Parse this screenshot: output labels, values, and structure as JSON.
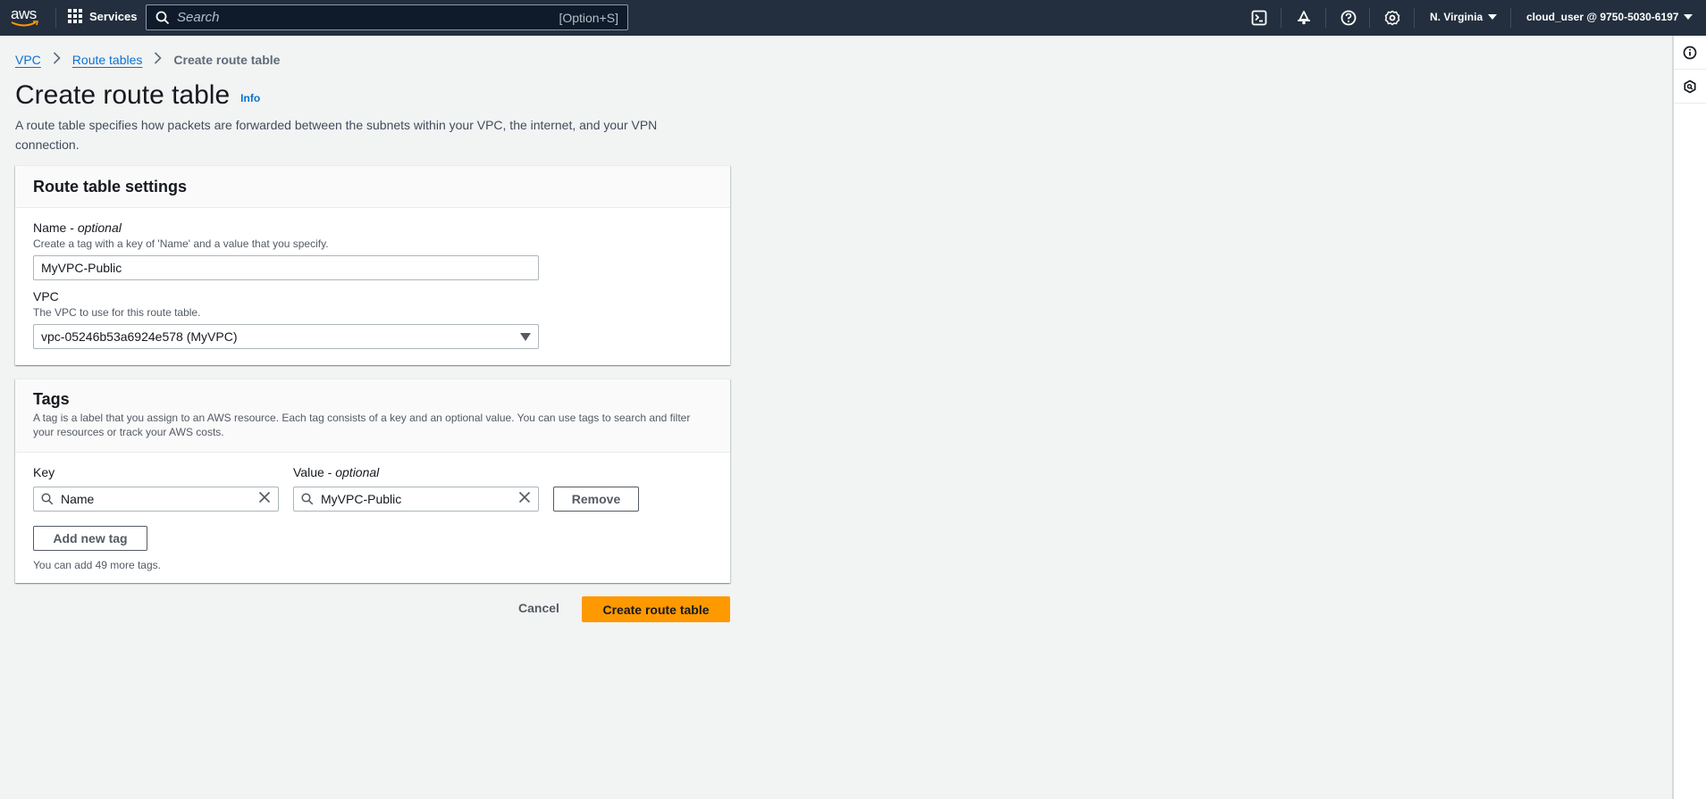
{
  "topnav": {
    "logo_text": "aws",
    "services_label": "Services",
    "search_placeholder": "Search",
    "search_shortcut": "[Option+S]",
    "icons": [
      "cloudshell-icon",
      "notifications-bell-icon",
      "help-icon",
      "settings-gear-icon"
    ],
    "region_label": "N. Virginia",
    "account_label": "cloud_user @ 9750-5030-6197"
  },
  "right_rail": {
    "icons": [
      "info-panel-icon",
      "security-hexagon-icon"
    ]
  },
  "breadcrumb": {
    "items": [
      "VPC",
      "Route tables"
    ],
    "current": "Create route table"
  },
  "page": {
    "title": "Create route table",
    "info_label": "Info",
    "description": "A route table specifies how packets are forwarded between the subnets within your VPC, the internet, and your VPN connection."
  },
  "settings_panel": {
    "title": "Route table settings",
    "name_label": "Name",
    "name_optional": "optional",
    "name_hint": "Create a tag with a key of 'Name' and a value that you specify.",
    "name_value": "MyVPC-Public",
    "vpc_label": "VPC",
    "vpc_hint": "The VPC to use for this route table.",
    "vpc_selected": "vpc-05246b53a6924e578 (MyVPC)"
  },
  "tags_panel": {
    "title": "Tags",
    "description": "A tag is a label that you assign to an AWS resource. Each tag consists of a key and an optional value. You can use tags to search and filter your resources or track your AWS costs.",
    "key_label": "Key",
    "value_label": "Value",
    "value_optional": "optional",
    "tags": [
      {
        "key": "Name",
        "value": "MyVPC-Public"
      }
    ],
    "remove_label": "Remove",
    "add_label": "Add new tag",
    "remaining_text": "You can add 49 more tags."
  },
  "actions": {
    "cancel_label": "Cancel",
    "submit_label": "Create route table"
  },
  "colors": {
    "nav_bg": "#232f3e",
    "link": "#0972d3",
    "primary_button": "#ff9900",
    "page_bg": "#f2f3f3"
  }
}
